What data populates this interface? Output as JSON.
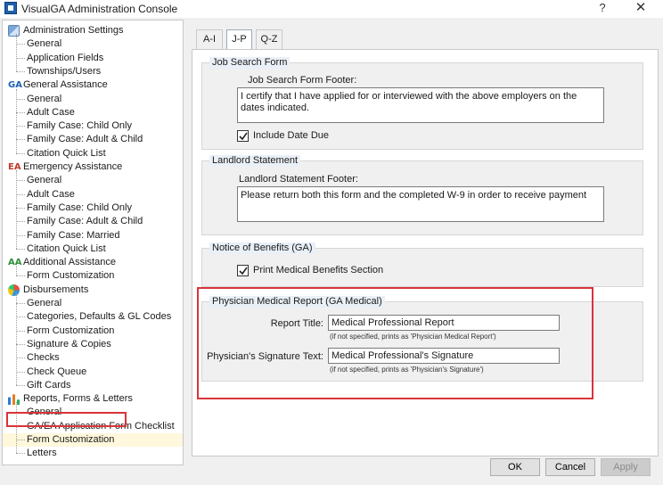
{
  "window": {
    "title": "VisualGA Administration Console",
    "help_glyph": "?",
    "close_glyph": "✕"
  },
  "tree": {
    "groups": [
      {
        "label": "Administration Settings",
        "icon": "admin-settings-icon",
        "children": [
          "General",
          "Application Fields",
          "Townships/Users"
        ]
      },
      {
        "label": "General Assistance",
        "icon": "ga-icon",
        "children": [
          "General",
          "Adult Case",
          "Family Case: Child Only",
          "Family Case: Adult & Child",
          "Citation Quick List"
        ]
      },
      {
        "label": "Emergency Assistance",
        "icon": "ea-icon",
        "children": [
          "General",
          "Adult Case",
          "Family Case: Child Only",
          "Family Case: Adult & Child",
          "Family Case: Married",
          "Citation Quick List"
        ]
      },
      {
        "label": "Additional Assistance",
        "icon": "aa-icon",
        "children": [
          "Form Customization"
        ]
      },
      {
        "label": "Disbursements",
        "icon": "disbursements-pie-icon",
        "children": [
          "General",
          "Categories, Defaults & GL Codes",
          "Form Customization",
          "Signature & Copies",
          "Checks",
          "Check Queue",
          "Gift Cards"
        ]
      },
      {
        "label": "Reports, Forms & Letters",
        "icon": "reports-chart-icon",
        "children": [
          "General",
          "GA/EA Application Form Checklist",
          "Form Customization",
          "Letters"
        ]
      }
    ],
    "selected": "Reports, Forms & Letters > Form Customization"
  },
  "tabs": [
    {
      "label": "A-I",
      "active": false
    },
    {
      "label": "J-P",
      "active": true
    },
    {
      "label": "Q-Z",
      "active": false
    }
  ],
  "job_search": {
    "group_title": "Job Search Form",
    "footer_label": "Job Search Form Footer:",
    "footer_value": "I certify that I have applied for or interviewed with the above employers on the dates indicated.",
    "include_due_label": "Include Date Due",
    "include_due_checked": true
  },
  "landlord": {
    "group_title": "Landlord Statement",
    "footer_label": "Landlord Statement Footer:",
    "footer_value": "Please return both this form and the completed W-9 in order to receive payment"
  },
  "notice": {
    "group_title": "Notice of Benefits (GA)",
    "print_medical_label": "Print Medical Benefits Section",
    "print_medical_checked": true
  },
  "physician": {
    "group_title": "Physician Medical Report (GA Medical)",
    "report_title_label": "Report Title:",
    "report_title_value": "Medical Professional Report",
    "report_title_hint": "(if not specified, prints as 'Physician Medical Report')",
    "signature_label": "Physician's Signature Text:",
    "signature_value": "Medical Professional's Signature",
    "signature_hint": "(if not specified, prints as 'Physician's Signature')"
  },
  "buttons": {
    "ok": "OK",
    "cancel": "Cancel",
    "apply": "Apply",
    "apply_enabled": false
  },
  "colors": {
    "highlight_box": "#d9343a",
    "selected_row": "#fff8dc"
  }
}
